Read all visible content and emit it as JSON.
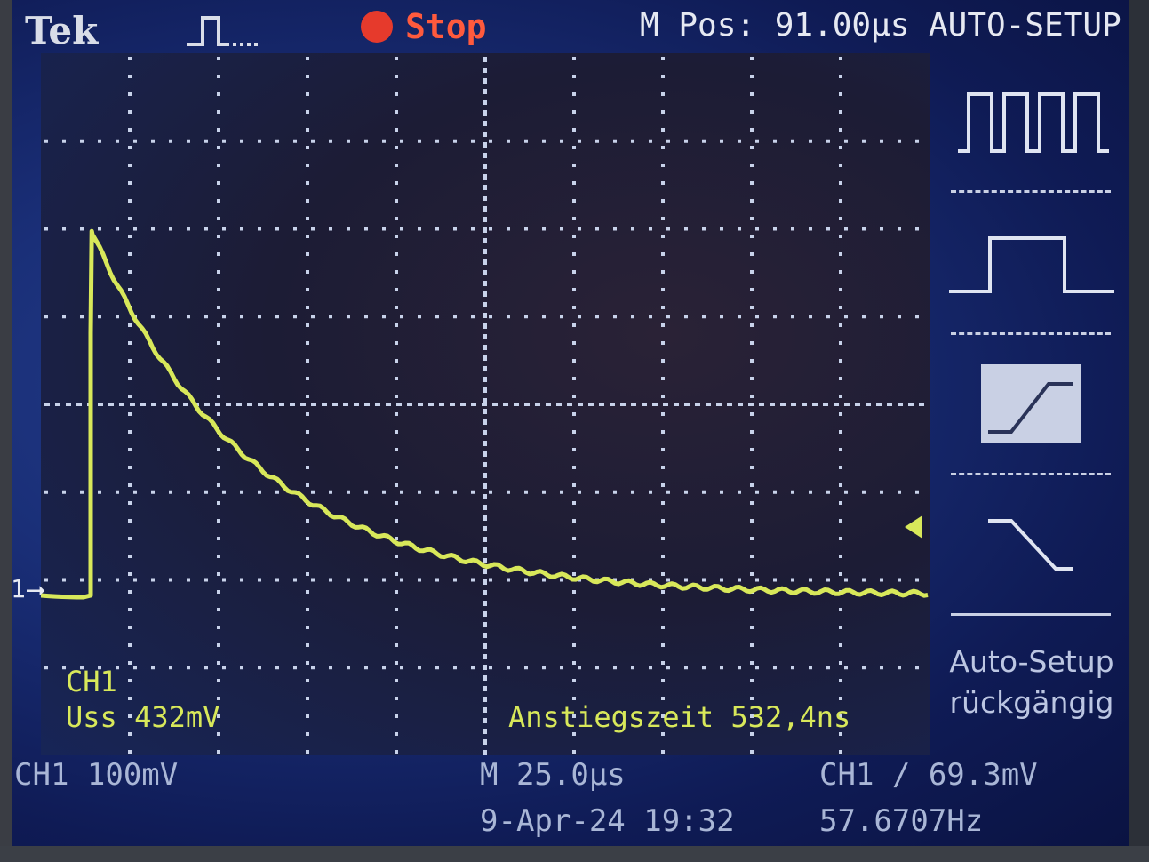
{
  "header": {
    "brand": "Tek",
    "acquisition_icon": "pulse-acquisition-icon",
    "run_state": "Stop",
    "run_state_color": "#e63a2c",
    "horizontal_position": "M Pos: 91.00µs",
    "menu_title": "AUTO-SETUP"
  },
  "waveform": {
    "channel_marker": "1",
    "trace_color": "#d8e85a",
    "measurements": [
      {
        "label": "CH1"
      },
      {
        "label": "Uss 432mV"
      }
    ],
    "rise_time": "Anstiegszeit 532,4ns"
  },
  "status": {
    "ch1_scale": "CH1  100mV",
    "timebase": "M 25.0µs",
    "date_time": "9-Apr-24 19:32",
    "trigger": "CH1 ∕ 69.3mV",
    "frequency": "57.6707Hz"
  },
  "side_menu": {
    "items": [
      {
        "icon": "multi-cycle-square-wave-icon"
      },
      {
        "icon": "single-cycle-pulse-icon"
      },
      {
        "icon": "rising-edge-icon",
        "selected": true
      },
      {
        "icon": "falling-edge-icon"
      }
    ],
    "undo_line1": "Auto-Setup",
    "undo_line2": "rückgängig"
  },
  "signal": {
    "baseline_mV": 0,
    "peak_mV": 415,
    "step_time_us": 14,
    "decay_tau_us": 45,
    "time_range_us": [
      0,
      250
    ],
    "volt_per_div_mV": 100,
    "time_per_div_us": 25
  }
}
